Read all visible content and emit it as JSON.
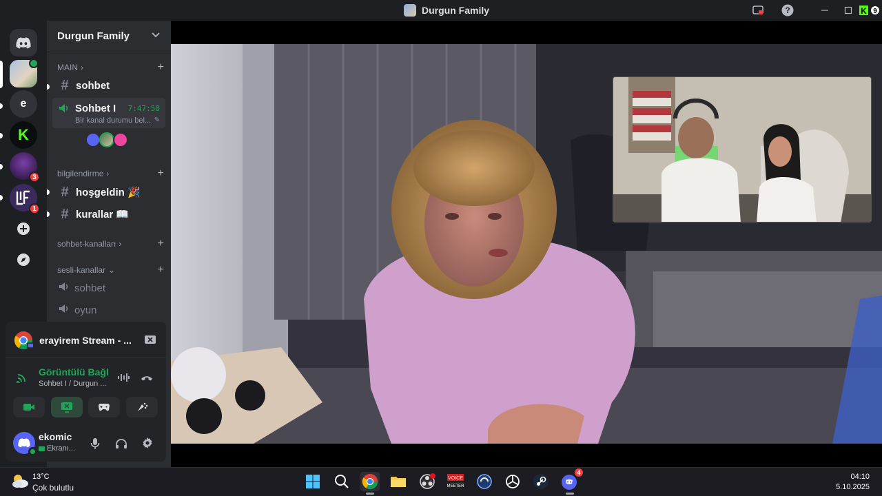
{
  "window": {
    "title": "Durgun Family",
    "controls": [
      "minimize-icon",
      "maximize-icon",
      "close-icon"
    ]
  },
  "servers": {
    "items": [
      {
        "name": "discord-home",
        "label": ""
      },
      {
        "name": "durgun-family",
        "label": ""
      },
      {
        "name": "server-e",
        "label": "e"
      },
      {
        "name": "server-kick",
        "label": "K"
      },
      {
        "name": "server-4",
        "label": "",
        "badge": "3"
      },
      {
        "name": "server-5",
        "label": "",
        "badge": "1"
      }
    ]
  },
  "guild": {
    "name": "Durgun Family"
  },
  "categories": {
    "main": "MAIN",
    "bilgilendirme": "bilgilendirme",
    "sohbet_kanallari": "sohbet-kanalları",
    "sesli_kanallar": "sesli-kanallar"
  },
  "channels": {
    "sohbet": "sohbet",
    "voice_active": {
      "name": "Sohbet I",
      "timer": "7:47:58",
      "status": "Bir kanal durumu bel..."
    },
    "hosgeldin": "hoşgeldin 🎉",
    "kurallar": "kurallar 📖",
    "voice_sohbet": "sohbet",
    "voice_oyun": "oyun"
  },
  "voice_panel": {
    "stream_title": "erayirem Stream - ...",
    "connection": "Görüntülü Bağl",
    "connection_sub": "Sohbet I / Durgun ...",
    "user_name": "ekomic",
    "user_status": "Ekranı..."
  },
  "taskbar": {
    "weather_temp": "13°C",
    "weather_desc": "Çok bulutlu",
    "time": "04:10",
    "date": "5.10.2025",
    "discord_badge": "4"
  },
  "colors": {
    "accent_green": "#23a559",
    "brand": "#5865f2",
    "danger": "#f23f43"
  }
}
